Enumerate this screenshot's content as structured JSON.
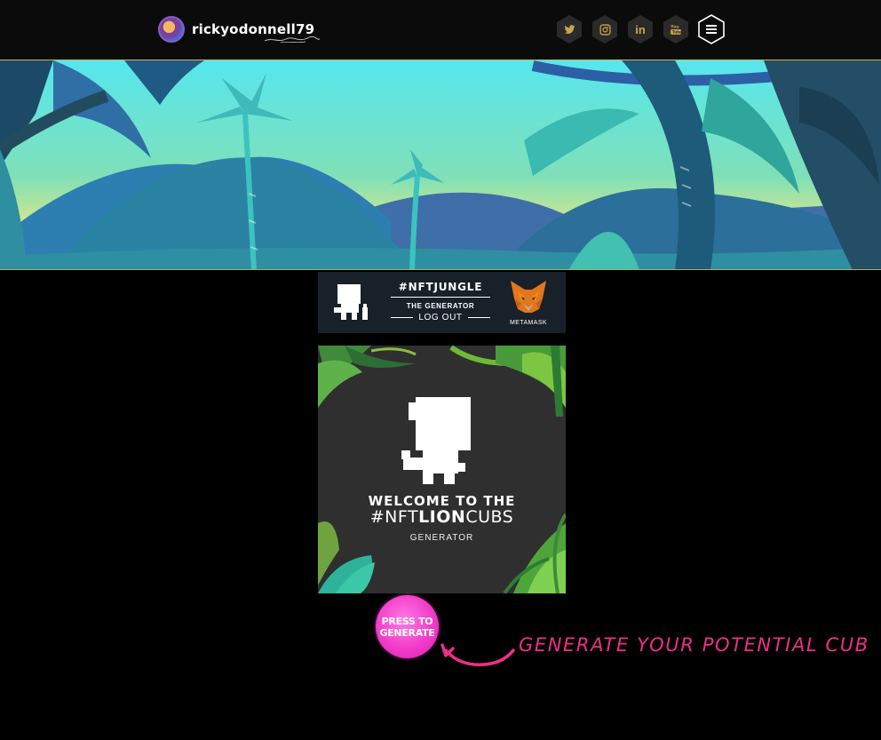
{
  "header": {
    "username": "rickyodonnell79",
    "socials": [
      {
        "icon": "twitter-icon",
        "glyph": "🐦"
      },
      {
        "icon": "instagram-icon",
        "glyph": "◎"
      },
      {
        "icon": "linkedin-icon",
        "glyph": "in"
      },
      {
        "icon": "youtube-icon",
        "glyph": "▶"
      }
    ],
    "menu_icon": "hamburger-menu-icon"
  },
  "generator_bar": {
    "tag": "#NFTJUNGLE",
    "subtitle": "THE GENERATOR",
    "logout_label": "LOG OUT",
    "metamask_label": "METAMASK"
  },
  "card": {
    "welcome": "WELCOME TO THE",
    "hashtag_prefix": "#NFT",
    "hashtag_bold": "LION",
    "hashtag_suffix": "CUBS",
    "subtitle": "GENERATOR"
  },
  "generate_button": {
    "line1": "PRESS TO",
    "line2": "GENERATE"
  },
  "hint_text": "GENERATE YOUR POTENTIAL CUB",
  "colors": {
    "accent_gold": "#c9a84a",
    "accent_pink": "#ee2f86",
    "button_pink": "#f23cc9",
    "banner_sky": "#56e3ea"
  }
}
